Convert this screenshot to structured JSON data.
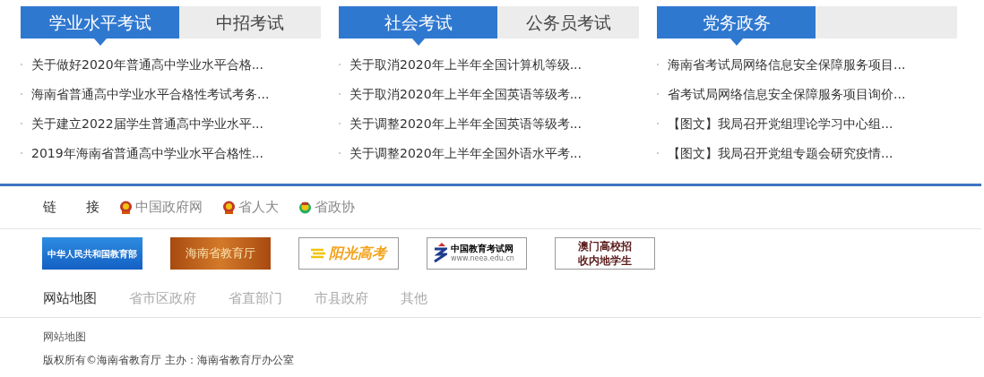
{
  "news_panels": [
    {
      "tabs": [
        {
          "label": "学业水平考试",
          "selected": true
        },
        {
          "label": "中招考试",
          "selected": false
        }
      ],
      "items": [
        "关于做好2020年普通高中学业水平合格...",
        "海南省普通高中学业水平合格性考试考务...",
        "关于建立2022届学生普通高中学业水平...",
        "2019年海南省普通高中学业水平合格性..."
      ]
    },
    {
      "tabs": [
        {
          "label": "社会考试",
          "selected": true
        },
        {
          "label": "公务员考试",
          "selected": false
        }
      ],
      "items": [
        "关于取消2020年上半年全国计算机等级...",
        "关于取消2020年上半年全国英语等级考...",
        "关于调整2020年上半年全国英语等级考...",
        "关于调整2020年上半年全国外语水平考..."
      ]
    },
    {
      "tabs": [
        {
          "label": "党务政务",
          "selected": true
        }
      ],
      "items": [
        "海南省考试局网络信息安全保障服务项目...",
        "省考试局网络信息安全保障服务项目询价...",
        "【图文】我局召开党组理论学习中心组...",
        "【图文】我局召开党组专题会研究疫情..."
      ]
    }
  ],
  "links": {
    "label": [
      "链",
      "接"
    ],
    "items": [
      {
        "text": "中国政府网",
        "kind": "emblem"
      },
      {
        "text": "省人大",
        "kind": "emblem"
      },
      {
        "text": "省政协",
        "kind": "cppcc"
      }
    ]
  },
  "banners": [
    {
      "kind": "blue",
      "lines": [
        "中华人民共和国教育部"
      ]
    },
    {
      "kind": "brown",
      "lines": [
        "海南省教育厅"
      ]
    },
    {
      "kind": "sun",
      "lines": [
        "阳光高考"
      ]
    },
    {
      "kind": "neea",
      "lines": [
        "中国教育考试网",
        "www.neea.edu.cn"
      ]
    },
    {
      "kind": "boxed",
      "lines": [
        "澳门高校招",
        "收内地学生"
      ]
    }
  ],
  "sitemap_tabs": [
    {
      "label": "网站地图",
      "selected": true
    },
    {
      "label": "省市区政府",
      "selected": false
    },
    {
      "label": "省直部门",
      "selected": false
    },
    {
      "label": "市县政府",
      "selected": false
    },
    {
      "label": "其他",
      "selected": false
    }
  ],
  "footer": {
    "title": "网站地图",
    "copyright": "版权所有©海南省教育厅 主办：海南省教育厅办公室"
  }
}
